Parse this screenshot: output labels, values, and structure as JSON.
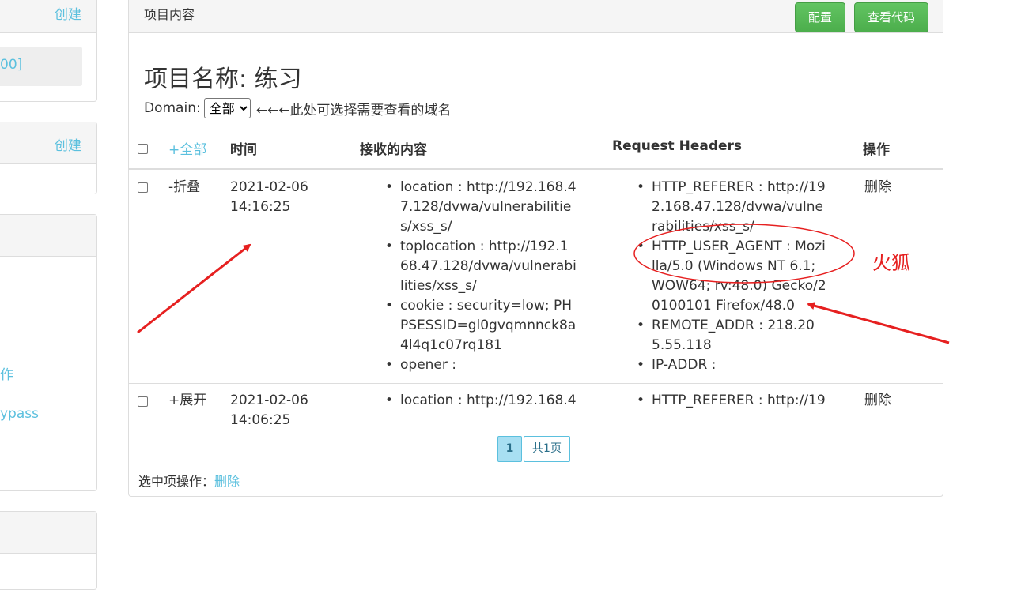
{
  "sidebar": {
    "panels": [
      {
        "create_label": "创建",
        "item_label": "00]"
      },
      {
        "create_label": "创建"
      },
      {
        "items": [
          "作",
          "ypass"
        ]
      }
    ]
  },
  "main": {
    "heading": "项目内容",
    "buttons": {
      "config": "配置",
      "view_code": "查看代码"
    },
    "project_title": "项目名称: 练习",
    "domain_label": "Domain:",
    "domain_options": [
      "全部"
    ],
    "domain_selected": "全部",
    "domain_hint": "←←←此处可选择需要查看的域名",
    "table": {
      "headers": {
        "toggle_all": "+全部",
        "time": "时间",
        "content": "接收的内容",
        "headers": "Request Headers",
        "action": "操作"
      },
      "rows": [
        {
          "toggle": "-折叠",
          "time": "2021-02-06 14:16:25",
          "content": [
            "location : http://192.168.47.128/dvwa/vulnerabilities/xss_s/",
            "toplocation : http://192.168.47.128/dvwa/vulnerabilities/xss_s/",
            "cookie : security=low; PHPSESSID=gl0gvqmnnck8a4l4q1c07rq181",
            "opener :"
          ],
          "headers": [
            "HTTP_REFERER : http://192.168.47.128/dvwa/vulnerabilities/xss_s/",
            "HTTP_USER_AGENT : Mozilla/5.0 (Windows NT 6.1; WOW64; rv:48.0) Gecko/20100101 Firefox/48.0",
            "REMOTE_ADDR : 218.205.55.118",
            "IP-ADDR :"
          ],
          "action": "删除"
        },
        {
          "toggle": "+展开",
          "time": "2021-02-06 14:06:25",
          "content": [
            "location : http://192.168.4"
          ],
          "headers": [
            "HTTP_REFERER : http://19"
          ],
          "action": "删除"
        }
      ]
    },
    "pagination": {
      "current": "1",
      "total": "共1页"
    },
    "bulk": {
      "label": "选中项操作：",
      "action": "删除"
    }
  },
  "annotation": {
    "label": "火狐",
    "color": "#e62020"
  }
}
